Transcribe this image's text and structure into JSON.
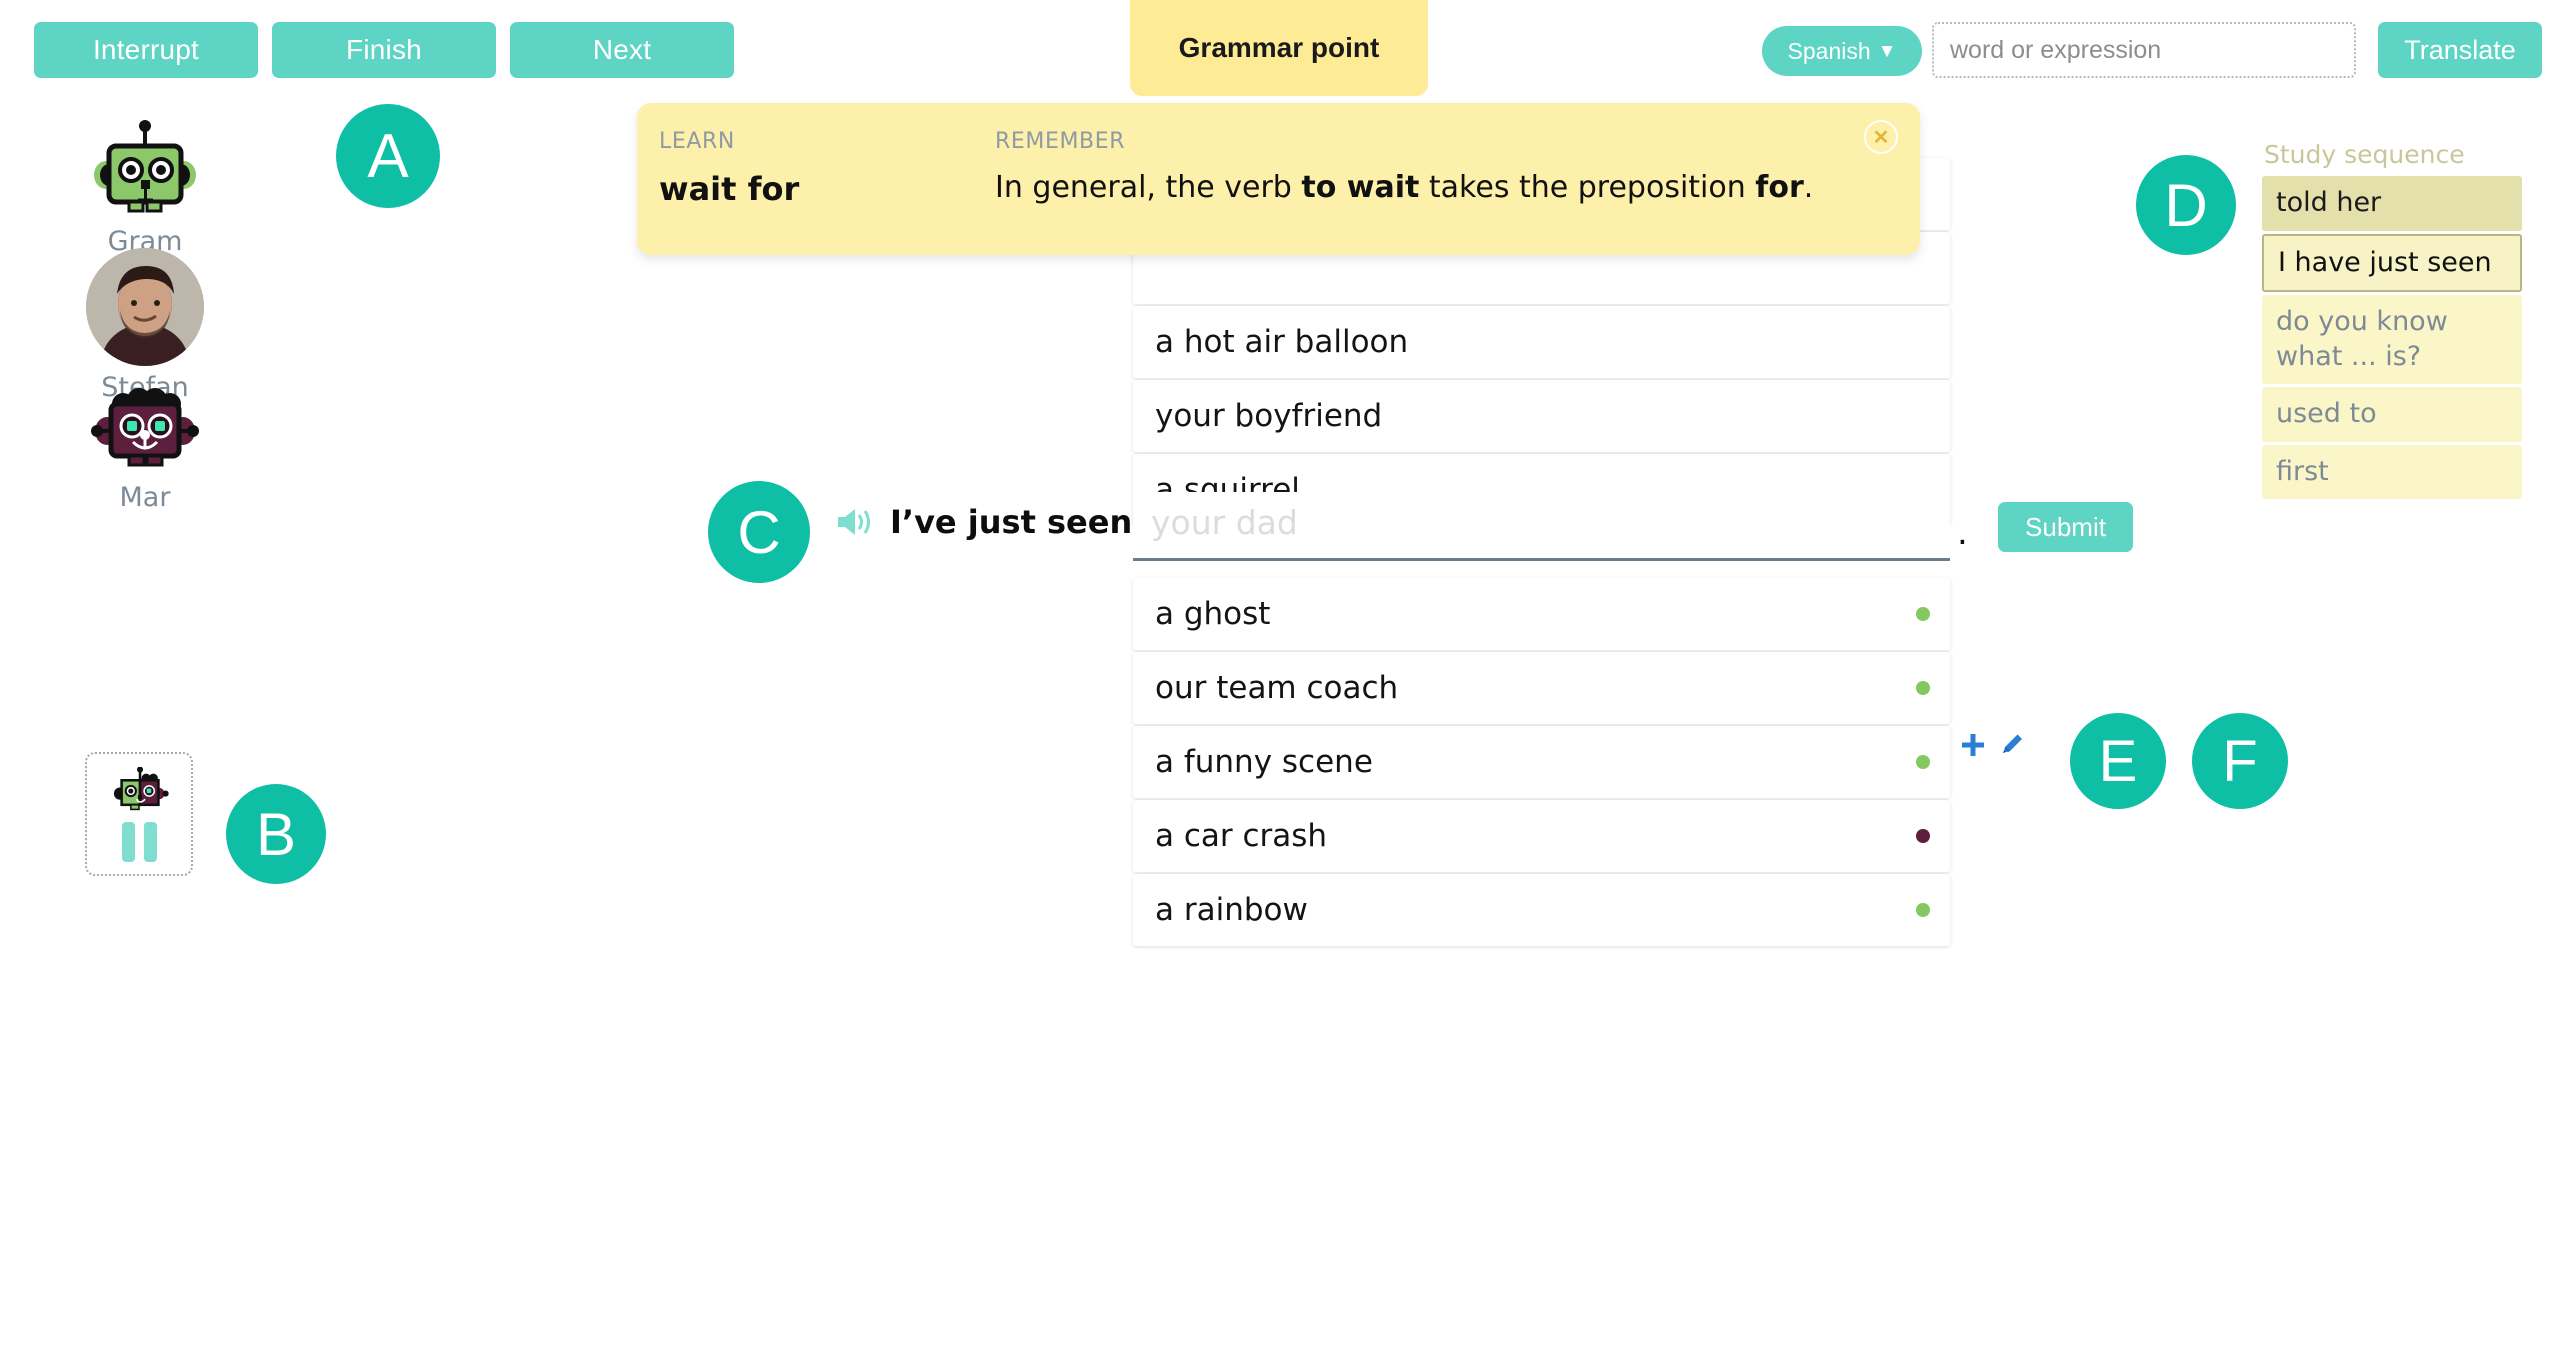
{
  "toolbar": {
    "interrupt_label": "Interrupt",
    "finish_label": "Finish",
    "next_label": "Next",
    "grammar_tab_label": "Grammar point",
    "language_label": "Spanish",
    "language_caret": "▼",
    "translate_placeholder": "word or expression",
    "translate_value": "",
    "translate_label": "Translate"
  },
  "avatars": [
    {
      "name": "Gram",
      "type": "robot-green"
    },
    {
      "name": "Stefan",
      "type": "photo"
    },
    {
      "name": "Mar",
      "type": "robot-purple"
    }
  ],
  "pause_card": {
    "state": "paused"
  },
  "badges": {
    "a": "A",
    "b": "B",
    "c": "C",
    "d": "D",
    "e": "E",
    "f": "F"
  },
  "grammar_callout": {
    "learn_kicker": "LEARN",
    "learn_term": "wait for",
    "remember_kicker": "REMEMBER",
    "remember_prefix": "In general, the verb ",
    "remember_bold_1": "to wait",
    "remember_middle": " takes the preposition ",
    "remember_bold_2": "for",
    "remember_suffix": ".",
    "close_label": "✕"
  },
  "exercise": {
    "prompt_text": "I’ve just seen",
    "speaker_icon": "speaker-icon",
    "input_value": "",
    "input_placeholder": "your dad",
    "period": ".",
    "submit_label": "Submit",
    "rows_above": [
      {
        "label": "a hot air balloon",
        "dot": ""
      },
      {
        "label": "your boyfriend",
        "dot": ""
      },
      {
        "label": "a squirrel",
        "dot": ""
      }
    ],
    "rows_hidden_above": [
      {
        "label": "",
        "dot": ""
      },
      {
        "label": "",
        "dot": ""
      }
    ],
    "rows_below": [
      {
        "label": "a ghost",
        "dot": "#84c861"
      },
      {
        "label": "our team coach",
        "dot": "#84c861"
      },
      {
        "label": "a funny scene",
        "dot": "#84c861"
      },
      {
        "label": "a car crash",
        "dot": "#5c1f3e"
      },
      {
        "label": "a rainbow",
        "dot": "#84c861"
      }
    ],
    "row_actions": {
      "add_icon": "plus-icon",
      "edit_icon": "pencil-icon"
    }
  },
  "study_sequence": {
    "title": "Study sequence",
    "items": [
      {
        "label": "told her",
        "state": "done"
      },
      {
        "label": "I have just seen",
        "state": "current"
      },
      {
        "label": "do you know what ... is?",
        "state": "future"
      },
      {
        "label": "used to",
        "state": "future"
      },
      {
        "label": "first",
        "state": "future"
      }
    ]
  },
  "colors": {
    "accent_teal": "#5ed4c4",
    "badge_teal": "#0fbfa5",
    "callout_yellow": "#fdf0ab",
    "tab_yellow": "#fdeb96",
    "dot_green": "#84c861",
    "dot_maroon": "#5c1f3e",
    "icon_blue": "#2a7fd4"
  }
}
